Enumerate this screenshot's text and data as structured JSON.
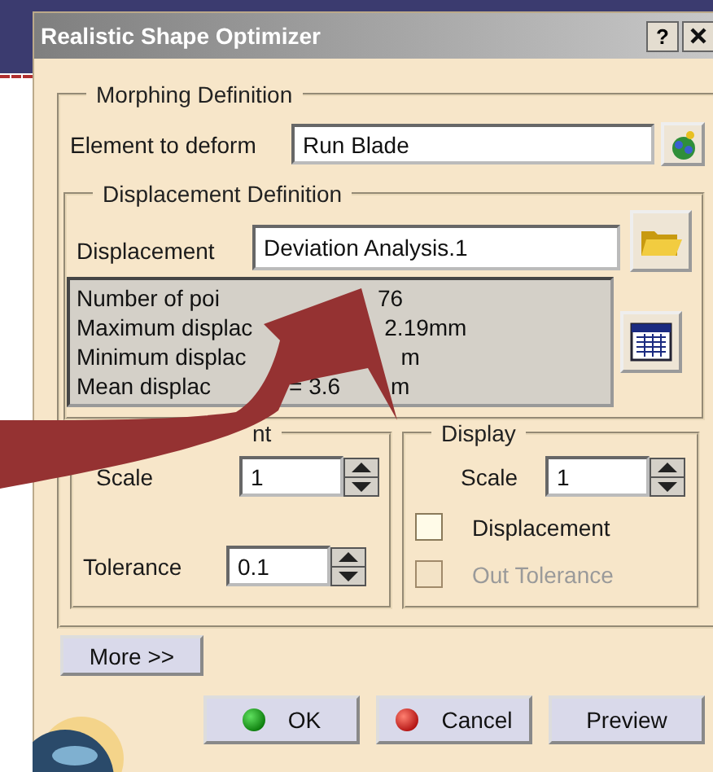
{
  "window": {
    "title": "Realistic Shape Optimizer",
    "help_button": "?"
  },
  "morphing_definition": {
    "legend": "Morphing Definition",
    "element_label": "Element to deform",
    "element_value": "Run Blade"
  },
  "displacement_definition": {
    "legend": "Displacement Definition",
    "displacement_label": "Displacement",
    "displacement_value": "Deviation Analysis.1",
    "info_lines": [
      {
        "parts": [
          "Number of poi",
          "76"
        ]
      },
      {
        "parts": [
          "Maximum displac",
          "2.19mm"
        ]
      },
      {
        "parts": [
          "Minimum displac",
          "m"
        ]
      },
      {
        "parts": [
          "Mean displac",
          "= 3.6",
          "m"
        ]
      }
    ]
  },
  "displacement_group": {
    "legend_fragment": "nt",
    "scale_label": "Scale",
    "scale_value": "1",
    "tolerance_label": "Tolerance",
    "tolerance_value": "0.1"
  },
  "display_group": {
    "legend": "Display",
    "scale_label": "Scale",
    "scale_value": "1",
    "options": [
      {
        "label": "Displacement",
        "checked": false,
        "disabled": false
      },
      {
        "label": "Out Tolerance",
        "checked": false,
        "disabled": true
      }
    ]
  },
  "more_button": "More >>",
  "buttons": [
    {
      "label": "OK",
      "kind": "ok"
    },
    {
      "label": "Cancel",
      "kind": "cancel"
    },
    {
      "label": "Preview",
      "kind": "plain"
    }
  ]
}
